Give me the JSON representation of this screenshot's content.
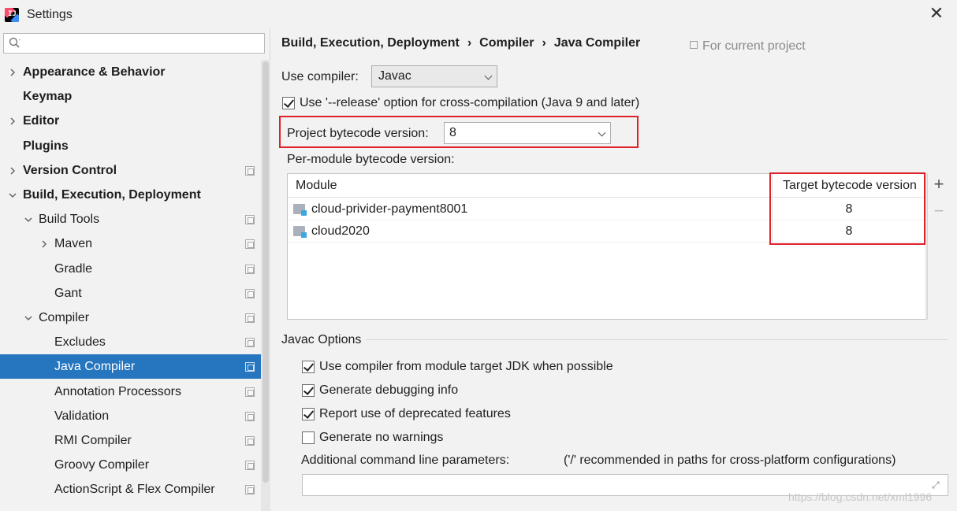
{
  "window": {
    "title": "Settings",
    "app_icon_letters": "IJ",
    "close_glyph": "✕"
  },
  "sidebar": {
    "search_placeholder": "",
    "items": [
      {
        "label": "Appearance & Behavior",
        "level": 0,
        "bold": true,
        "arrow": "right",
        "project_icon": false
      },
      {
        "label": "Keymap",
        "level": 0,
        "bold": true,
        "arrow": "none",
        "project_icon": false
      },
      {
        "label": "Editor",
        "level": 0,
        "bold": true,
        "arrow": "right",
        "project_icon": false
      },
      {
        "label": "Plugins",
        "level": 0,
        "bold": true,
        "arrow": "none",
        "project_icon": false
      },
      {
        "label": "Version Control",
        "level": 0,
        "bold": true,
        "arrow": "right",
        "project_icon": true
      },
      {
        "label": "Build, Execution, Deployment",
        "level": 0,
        "bold": true,
        "arrow": "down",
        "project_icon": false
      },
      {
        "label": "Build Tools",
        "level": 1,
        "bold": false,
        "arrow": "down",
        "project_icon": true
      },
      {
        "label": "Maven",
        "level": 2,
        "bold": false,
        "arrow": "right",
        "project_icon": true
      },
      {
        "label": "Gradle",
        "level": 2,
        "bold": false,
        "arrow": "none",
        "project_icon": true
      },
      {
        "label": "Gant",
        "level": 2,
        "bold": false,
        "arrow": "none",
        "project_icon": true
      },
      {
        "label": "Compiler",
        "level": 1,
        "bold": false,
        "arrow": "down",
        "project_icon": true
      },
      {
        "label": "Excludes",
        "level": 2,
        "bold": false,
        "arrow": "none",
        "project_icon": true
      },
      {
        "label": "Java Compiler",
        "level": 2,
        "bold": false,
        "arrow": "none",
        "project_icon": true,
        "selected": true
      },
      {
        "label": "Annotation Processors",
        "level": 2,
        "bold": false,
        "arrow": "none",
        "project_icon": true
      },
      {
        "label": "Validation",
        "level": 2,
        "bold": false,
        "arrow": "none",
        "project_icon": true
      },
      {
        "label": "RMI Compiler",
        "level": 2,
        "bold": false,
        "arrow": "none",
        "project_icon": true
      },
      {
        "label": "Groovy Compiler",
        "level": 2,
        "bold": false,
        "arrow": "none",
        "project_icon": true
      },
      {
        "label": "ActionScript & Flex Compiler",
        "level": 2,
        "bold": false,
        "arrow": "none",
        "project_icon": true
      }
    ]
  },
  "breadcrumb": {
    "items": [
      "Build, Execution, Deployment",
      "Compiler",
      "Java Compiler"
    ],
    "separator": "›"
  },
  "for_current_project": "For current project",
  "use_compiler": {
    "label": "Use compiler:",
    "value": "Javac"
  },
  "release_option": {
    "label": "Use '--release' option for cross-compilation (Java 9 and later)",
    "checked": true
  },
  "project_bytecode": {
    "label": "Project bytecode version:",
    "value": "8"
  },
  "per_module": {
    "label": "Per-module bytecode version:",
    "columns": [
      "Module",
      "Target bytecode version"
    ],
    "rows": [
      {
        "module": "cloud-privider-payment8001",
        "target": "8"
      },
      {
        "module": "cloud2020",
        "target": "8"
      }
    ],
    "add_glyph": "+",
    "remove_glyph": "−"
  },
  "javac_options": {
    "title": "Javac Options",
    "checkboxes": [
      {
        "label": "Use compiler from module target JDK when possible",
        "checked": true
      },
      {
        "label": "Generate debugging info",
        "checked": true
      },
      {
        "label": "Report use of deprecated features",
        "checked": true
      },
      {
        "label": "Generate no warnings",
        "checked": false
      }
    ],
    "additional_params_label": "Additional command line parameters:",
    "additional_params_hint": "('/' recommended in paths for cross-platform configurations)",
    "additional_params_value": ""
  },
  "watermark": "https://blog.csdn.net/xml1996",
  "colors": {
    "selection": "#2675bf",
    "highlight": "#e0212b",
    "background": "#f2f2f2"
  }
}
